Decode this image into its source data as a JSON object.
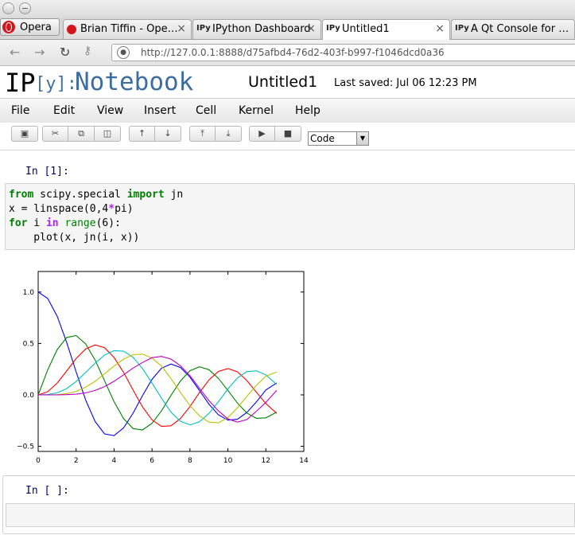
{
  "browser": {
    "menu_label": "Opera",
    "tabs": [
      {
        "icon": "opera-icon",
        "label": "Brian Tiffin - Ope…",
        "active": false
      },
      {
        "icon": "ipython-icon",
        "label": "IPython Dashboard",
        "active": false
      },
      {
        "icon": "ipython-icon",
        "label": "Untitled1",
        "active": true
      },
      {
        "icon": "ipython-icon",
        "label": "A Qt Console for …",
        "active": false
      }
    ],
    "tab_icon_text": "IPy",
    "close_glyph": "×",
    "url": "http://127.0.0.1:8888/d75afbd4-76d2-403f-b997-f1046dcd0a36"
  },
  "header": {
    "logo_ip": "IP",
    "logo_y": "[y]:",
    "logo_notebook": "Notebook",
    "notebook_name": "Untitled1",
    "last_saved": "Last saved: Jul 06 12:23 PM"
  },
  "menu": [
    "File",
    "Edit",
    "View",
    "Insert",
    "Cell",
    "Kernel",
    "Help"
  ],
  "toolbar": {
    "cell_type": "Code",
    "buttons": [
      "save-icon",
      "cut-icon",
      "copy-icon",
      "paste-icon",
      "move-up-icon",
      "move-down-icon",
      "insert-above-icon",
      "insert-below-icon",
      "run-icon",
      "stop-icon"
    ]
  },
  "cells": {
    "cell1_prompt": "In [1]:",
    "cell2_prompt": "In [ ]:"
  },
  "chart_data": {
    "type": "line",
    "title": "",
    "xlabel": "",
    "ylabel": "",
    "xlim": [
      0,
      14
    ],
    "ylim": [
      -0.55,
      1.2
    ],
    "xticks": [
      0,
      2,
      4,
      6,
      8,
      10,
      12,
      14
    ],
    "yticks": [
      -0.5,
      0.0,
      0.5,
      1.0
    ],
    "xtick_labels": [
      "0",
      "2",
      "4",
      "6",
      "8",
      "10",
      "12",
      "14"
    ],
    "ytick_labels": [
      "−0.5",
      "0.0",
      "0.5",
      "1.0"
    ],
    "grid": false,
    "series": [
      {
        "color": "#0000ff",
        "x": [
          0,
          0.5,
          1,
          1.5,
          2,
          2.5,
          3,
          3.5,
          4,
          4.5,
          5,
          5.5,
          6,
          6.5,
          7,
          7.5,
          8,
          8.5,
          9,
          9.5,
          10,
          10.5,
          11,
          11.5,
          12,
          12.566
        ],
        "y": [
          1.0,
          0.938,
          0.765,
          0.512,
          0.224,
          -0.048,
          -0.26,
          -0.38,
          -0.397,
          -0.321,
          -0.178,
          -0.007,
          0.151,
          0.26,
          0.3,
          0.266,
          0.172,
          0.042,
          -0.09,
          -0.194,
          -0.246,
          -0.237,
          -0.171,
          -0.068,
          0.048,
          0.115
        ]
      },
      {
        "color": "#008000",
        "x": [
          0,
          0.5,
          1,
          1.5,
          2,
          2.5,
          3,
          3.5,
          4,
          4.5,
          5,
          5.5,
          6,
          6.5,
          7,
          7.5,
          8,
          8.5,
          9,
          9.5,
          10,
          10.5,
          11,
          11.5,
          12,
          12.566
        ],
        "y": [
          0.0,
          0.242,
          0.44,
          0.558,
          0.577,
          0.497,
          0.339,
          0.137,
          -0.066,
          -0.231,
          -0.328,
          -0.341,
          -0.277,
          -0.154,
          -0.005,
          0.135,
          0.235,
          0.273,
          0.245,
          0.161,
          0.043,
          -0.079,
          -0.177,
          -0.228,
          -0.223,
          -0.169
        ]
      },
      {
        "color": "#ff0000",
        "x": [
          0,
          0.5,
          1,
          1.5,
          2,
          2.5,
          3,
          3.5,
          4,
          4.5,
          5,
          5.5,
          6,
          6.5,
          7,
          7.5,
          8,
          8.5,
          9,
          9.5,
          10,
          10.5,
          11,
          11.5,
          12,
          12.566
        ],
        "y": [
          0.0,
          0.031,
          0.115,
          0.232,
          0.353,
          0.446,
          0.486,
          0.459,
          0.364,
          0.218,
          0.047,
          -0.117,
          -0.243,
          -0.307,
          -0.301,
          -0.23,
          -0.113,
          0.022,
          0.145,
          0.228,
          0.255,
          0.224,
          0.139,
          0.025,
          -0.085,
          -0.18
        ]
      },
      {
        "color": "#00bfbf",
        "x": [
          0,
          0.5,
          1,
          1.5,
          2,
          2.5,
          3,
          3.5,
          4,
          4.5,
          5,
          5.5,
          6,
          6.5,
          7,
          7.5,
          8,
          8.5,
          9,
          9.5,
          10,
          10.5,
          11,
          11.5,
          12,
          12.566
        ],
        "y": [
          0.0,
          0.003,
          0.02,
          0.061,
          0.129,
          0.217,
          0.309,
          0.387,
          0.43,
          0.425,
          0.365,
          0.256,
          0.115,
          -0.033,
          -0.168,
          -0.258,
          -0.291,
          -0.262,
          -0.181,
          -0.067,
          0.058,
          0.164,
          0.227,
          0.234,
          0.195,
          0.102
        ]
      },
      {
        "color": "#bfbf00",
        "x": [
          0,
          0.5,
          1,
          1.5,
          2,
          2.5,
          3,
          3.5,
          4,
          4.5,
          5,
          5.5,
          6,
          6.5,
          7,
          7.5,
          8,
          8.5,
          9,
          9.5,
          10,
          10.5,
          11,
          11.5,
          12,
          12.566
        ],
        "y": [
          0.0,
          0.0,
          0.002,
          0.012,
          0.034,
          0.074,
          0.132,
          0.204,
          0.281,
          0.348,
          0.391,
          0.396,
          0.358,
          0.28,
          0.158,
          0.024,
          -0.105,
          -0.203,
          -0.265,
          -0.272,
          -0.22,
          -0.126,
          -0.015,
          0.093,
          0.182,
          0.221
        ]
      },
      {
        "color": "#bf00bf",
        "x": [
          0,
          0.5,
          1,
          1.5,
          2,
          2.5,
          3,
          3.5,
          4,
          4.5,
          5,
          5.5,
          6,
          6.5,
          7,
          7.5,
          8,
          8.5,
          9,
          9.5,
          10,
          10.5,
          11,
          11.5,
          12,
          12.566
        ],
        "y": [
          0.0,
          0.0,
          0.0,
          0.002,
          0.007,
          0.019,
          0.043,
          0.08,
          0.132,
          0.195,
          0.261,
          0.315,
          0.362,
          0.374,
          0.348,
          0.283,
          0.186,
          0.064,
          -0.055,
          -0.156,
          -0.234,
          -0.265,
          -0.24,
          -0.159,
          -0.073,
          0.043
        ]
      }
    ]
  }
}
